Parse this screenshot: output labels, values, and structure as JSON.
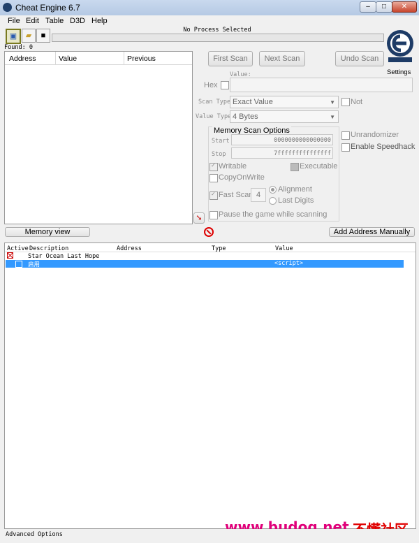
{
  "window": {
    "title": "Cheat Engine 6.7"
  },
  "menu": [
    "File",
    "Edit",
    "Table",
    "D3D",
    "Help"
  ],
  "toolbar": {
    "process_label": "No Process Selected",
    "found_label": "Found: 0"
  },
  "results": {
    "columns": [
      "Address",
      "Value",
      "Previous"
    ]
  },
  "scan": {
    "first_scan": "First Scan",
    "next_scan": "Next Scan",
    "undo_scan": "Undo Scan",
    "settings": "Settings",
    "value_label": "Value:",
    "hex_label": "Hex",
    "scan_type_label": "Scan Type",
    "scan_type_value": "Exact Value",
    "not_label": "Not",
    "value_type_label": "Value Type",
    "value_type_value": "4 Bytes",
    "mso_title": "Memory Scan Options",
    "start_label": "Start",
    "start_value": "0000000000000000",
    "stop_label": "Stop",
    "stop_value": "7fffffffffffffff",
    "writable": "Writable",
    "executable": "Executable",
    "copy_on_write": "CopyOnWrite",
    "fast_scan": "Fast Scan",
    "fast_scan_value": "4",
    "alignment": "Alignment",
    "last_digits": "Last Digits",
    "pause_game": "Pause the game while scanning",
    "unrandomizer": "Unrandomizer",
    "speedhack": "Enable Speedhack"
  },
  "buttons": {
    "memory_view": "Memory view",
    "add_address": "Add Address Manually"
  },
  "address_list": {
    "columns": [
      "Active",
      "Description",
      "Address",
      "Type",
      "Value"
    ],
    "rows": [
      {
        "description": "Star Ocean Last Hope",
        "address": "",
        "type": "",
        "value": ""
      },
      {
        "description": "启用",
        "address": "",
        "type": "",
        "value": "<script>"
      }
    ]
  },
  "status": {
    "advanced_options": "Advanced Options"
  },
  "watermark": {
    "url": "www.budog.net",
    "cn": "不懂社区"
  }
}
